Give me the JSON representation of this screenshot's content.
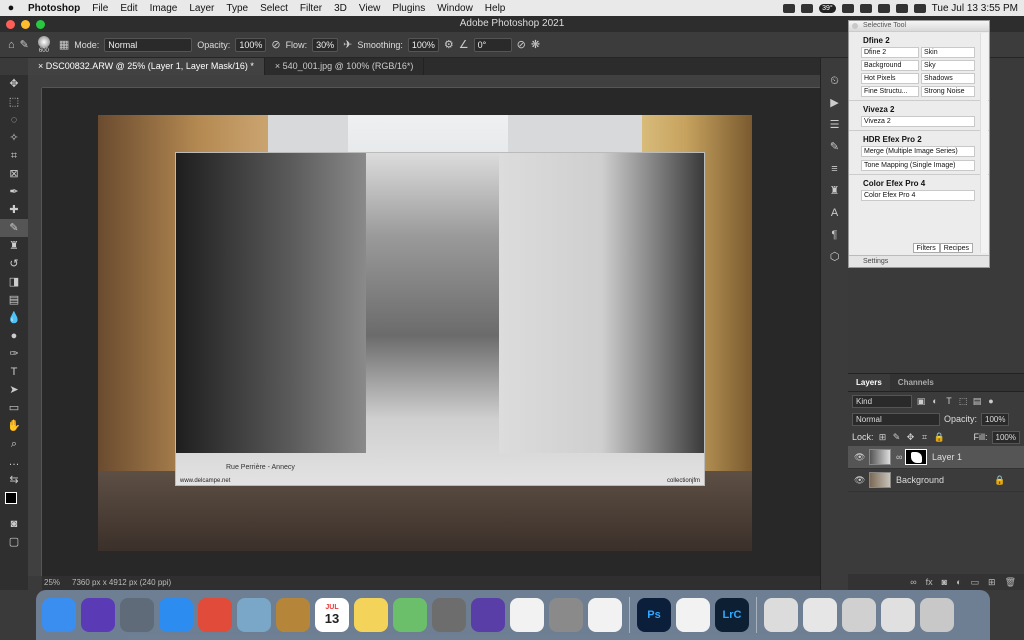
{
  "menubar": {
    "items": [
      "Photoshop",
      "File",
      "Edit",
      "Image",
      "Layer",
      "Type",
      "Select",
      "Filter",
      "3D",
      "View",
      "Plugins",
      "Window",
      "Help"
    ],
    "temperature": "39°",
    "datetime": "Tue Jul 13  3:55 PM"
  },
  "window": {
    "title": "Adobe Photoshop 2021"
  },
  "options": {
    "brush_size": "600",
    "mode_label": "Mode:",
    "mode_value": "Normal",
    "opacity_label": "Opacity:",
    "opacity_value": "100%",
    "flow_label": "Flow:",
    "flow_value": "30%",
    "smoothing_label": "Smoothing:",
    "smoothing_value": "100%",
    "angle_value": "0°"
  },
  "tabs": [
    {
      "label": "DSC00832.ARW @ 25% (Layer 1, Layer Mask/16) *"
    },
    {
      "label": "540_001.jpg @ 100% (RGB/16*)"
    }
  ],
  "document": {
    "overlay_caption_left": "Rue Perrière - Annecy",
    "overlay_caption_website": "www.delcampe.net",
    "overlay_caption_right": "collectionjfm"
  },
  "status": {
    "zoom": "25%",
    "info": "7360 px x 4912 px (240 ppi)"
  },
  "selective_tool": {
    "title": "Selective Tool",
    "sections": [
      {
        "name": "Dfine 2",
        "buttons": [
          "Dfine 2",
          "Skin",
          "Background",
          "Sky",
          "Hot Pixels",
          "Shadows",
          "Fine Structu...",
          "Strong Noise"
        ]
      },
      {
        "name": "Viveza 2",
        "buttons": [
          "Viveza 2"
        ]
      },
      {
        "name": "HDR Efex Pro 2",
        "buttons": [
          "Merge (Multiple Image Series)",
          "Tone Mapping (Single Image)"
        ]
      },
      {
        "name": "Color Efex Pro 4",
        "buttons": [
          "Color Efex Pro 4"
        ]
      }
    ],
    "tab_filters": "Filters",
    "tab_recipes": "Recipes",
    "settings": "Settings"
  },
  "layers_panel": {
    "tab_layers": "Layers",
    "tab_channels": "Channels",
    "kind": "Kind",
    "blend": "Normal",
    "opacity_label": "Opacity:",
    "opacity_value": "100%",
    "lock_label": "Lock:",
    "fill_label": "Fill:",
    "fill_value": "100%",
    "layers": [
      {
        "name": "Layer 1",
        "selected": true
      },
      {
        "name": "Background",
        "selected": false
      }
    ]
  },
  "dock": {
    "apps": [
      {
        "name": "Finder",
        "color": "#3a8ef0"
      },
      {
        "name": "Siri",
        "color": "#5b3bb5"
      },
      {
        "name": "Launchpad",
        "color": "#5f6b78"
      },
      {
        "name": "Safari",
        "color": "#2d8cf0"
      },
      {
        "name": "Chrome",
        "color": "#e04b3a"
      },
      {
        "name": "Preview",
        "color": "#7aa7c7"
      },
      {
        "name": "Notebooks",
        "color": "#b5863a"
      },
      {
        "name": "Calendar",
        "color": "#ffffff"
      },
      {
        "name": "Notes",
        "color": "#f3d35a"
      },
      {
        "name": "Maps",
        "color": "#6bbf6b"
      },
      {
        "name": "Calculator",
        "color": "#6d6d6d"
      },
      {
        "name": "iMovie",
        "color": "#5a3ea8"
      },
      {
        "name": "Music",
        "color": "#f2f2f2"
      },
      {
        "name": "System Preferences",
        "color": "#8a8a8a"
      },
      {
        "name": "Photos",
        "color": "#f2f2f2"
      },
      {
        "name": "Photoshop",
        "color": "#0b1e3a"
      },
      {
        "name": "TextEdit",
        "color": "#f2f2f2"
      },
      {
        "name": "Lightroom Classic",
        "color": "#0c1f33"
      },
      {
        "name": "Finder Window 1",
        "color": "#dcdcdc"
      },
      {
        "name": "Finder Window 2",
        "color": "#e6e6e6"
      },
      {
        "name": "Finder Window 3",
        "color": "#d0d0d0"
      },
      {
        "name": "Finder Window 4",
        "color": "#e0e0e0"
      },
      {
        "name": "Trash",
        "color": "#c8c8c8"
      }
    ],
    "calendar_month": "JUL",
    "calendar_day": "13",
    "ps_label": "Ps",
    "lrc_label": "LrC"
  }
}
